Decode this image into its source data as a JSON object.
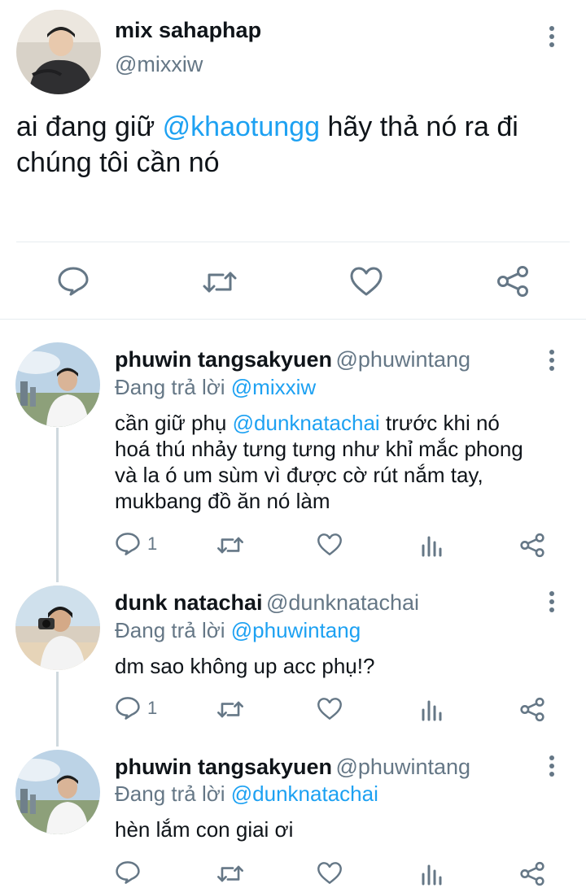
{
  "main_tweet": {
    "display_name": "mix sahaphap",
    "handle": "@mixxiw",
    "text_line1_pre": "ai đang giữ ",
    "text_mention": "@khaotungg",
    "text_line1_post": " hãy thả nó ra đi",
    "text_line2": "chúng tôi cần nó",
    "actions": [
      "reply-icon",
      "retweet-icon",
      "like-icon",
      "share-icon"
    ]
  },
  "replies": [
    {
      "display_name": "phuwin tangsakyuen",
      "handle": "@phuwintang",
      "replying_label": "Đang trả lời ",
      "replying_to": "@mixxiw",
      "text_pre": "cần giữ phụ ",
      "text_mention": "@dunknatachai",
      "text_post": " trước khi nó",
      "text_lines": [
        "hoá thú nhảy tưng tưng như khỉ mắc phong",
        "và la ó um sùm vì được cờ rút nắm tay,",
        "mukbang đồ ăn nó làm"
      ],
      "reply_count": "1"
    },
    {
      "display_name": "dunk natachai",
      "handle": "@dunknatachai",
      "replying_label": "Đang trả lời ",
      "replying_to": "@phuwintang",
      "text": "dm sao không up acc phụ!?",
      "reply_count": "1"
    },
    {
      "display_name": "phuwin tangsakyuen",
      "handle": "@phuwintang",
      "replying_label": "Đang trả lời ",
      "replying_to": "@dunknatachai",
      "text": "hèn lắm con giai ơi",
      "reply_count": ""
    }
  ],
  "colors": {
    "link": "#1da1f2",
    "secondary": "#657786",
    "divider": "#e6ecf0",
    "text": "#0f1419"
  }
}
